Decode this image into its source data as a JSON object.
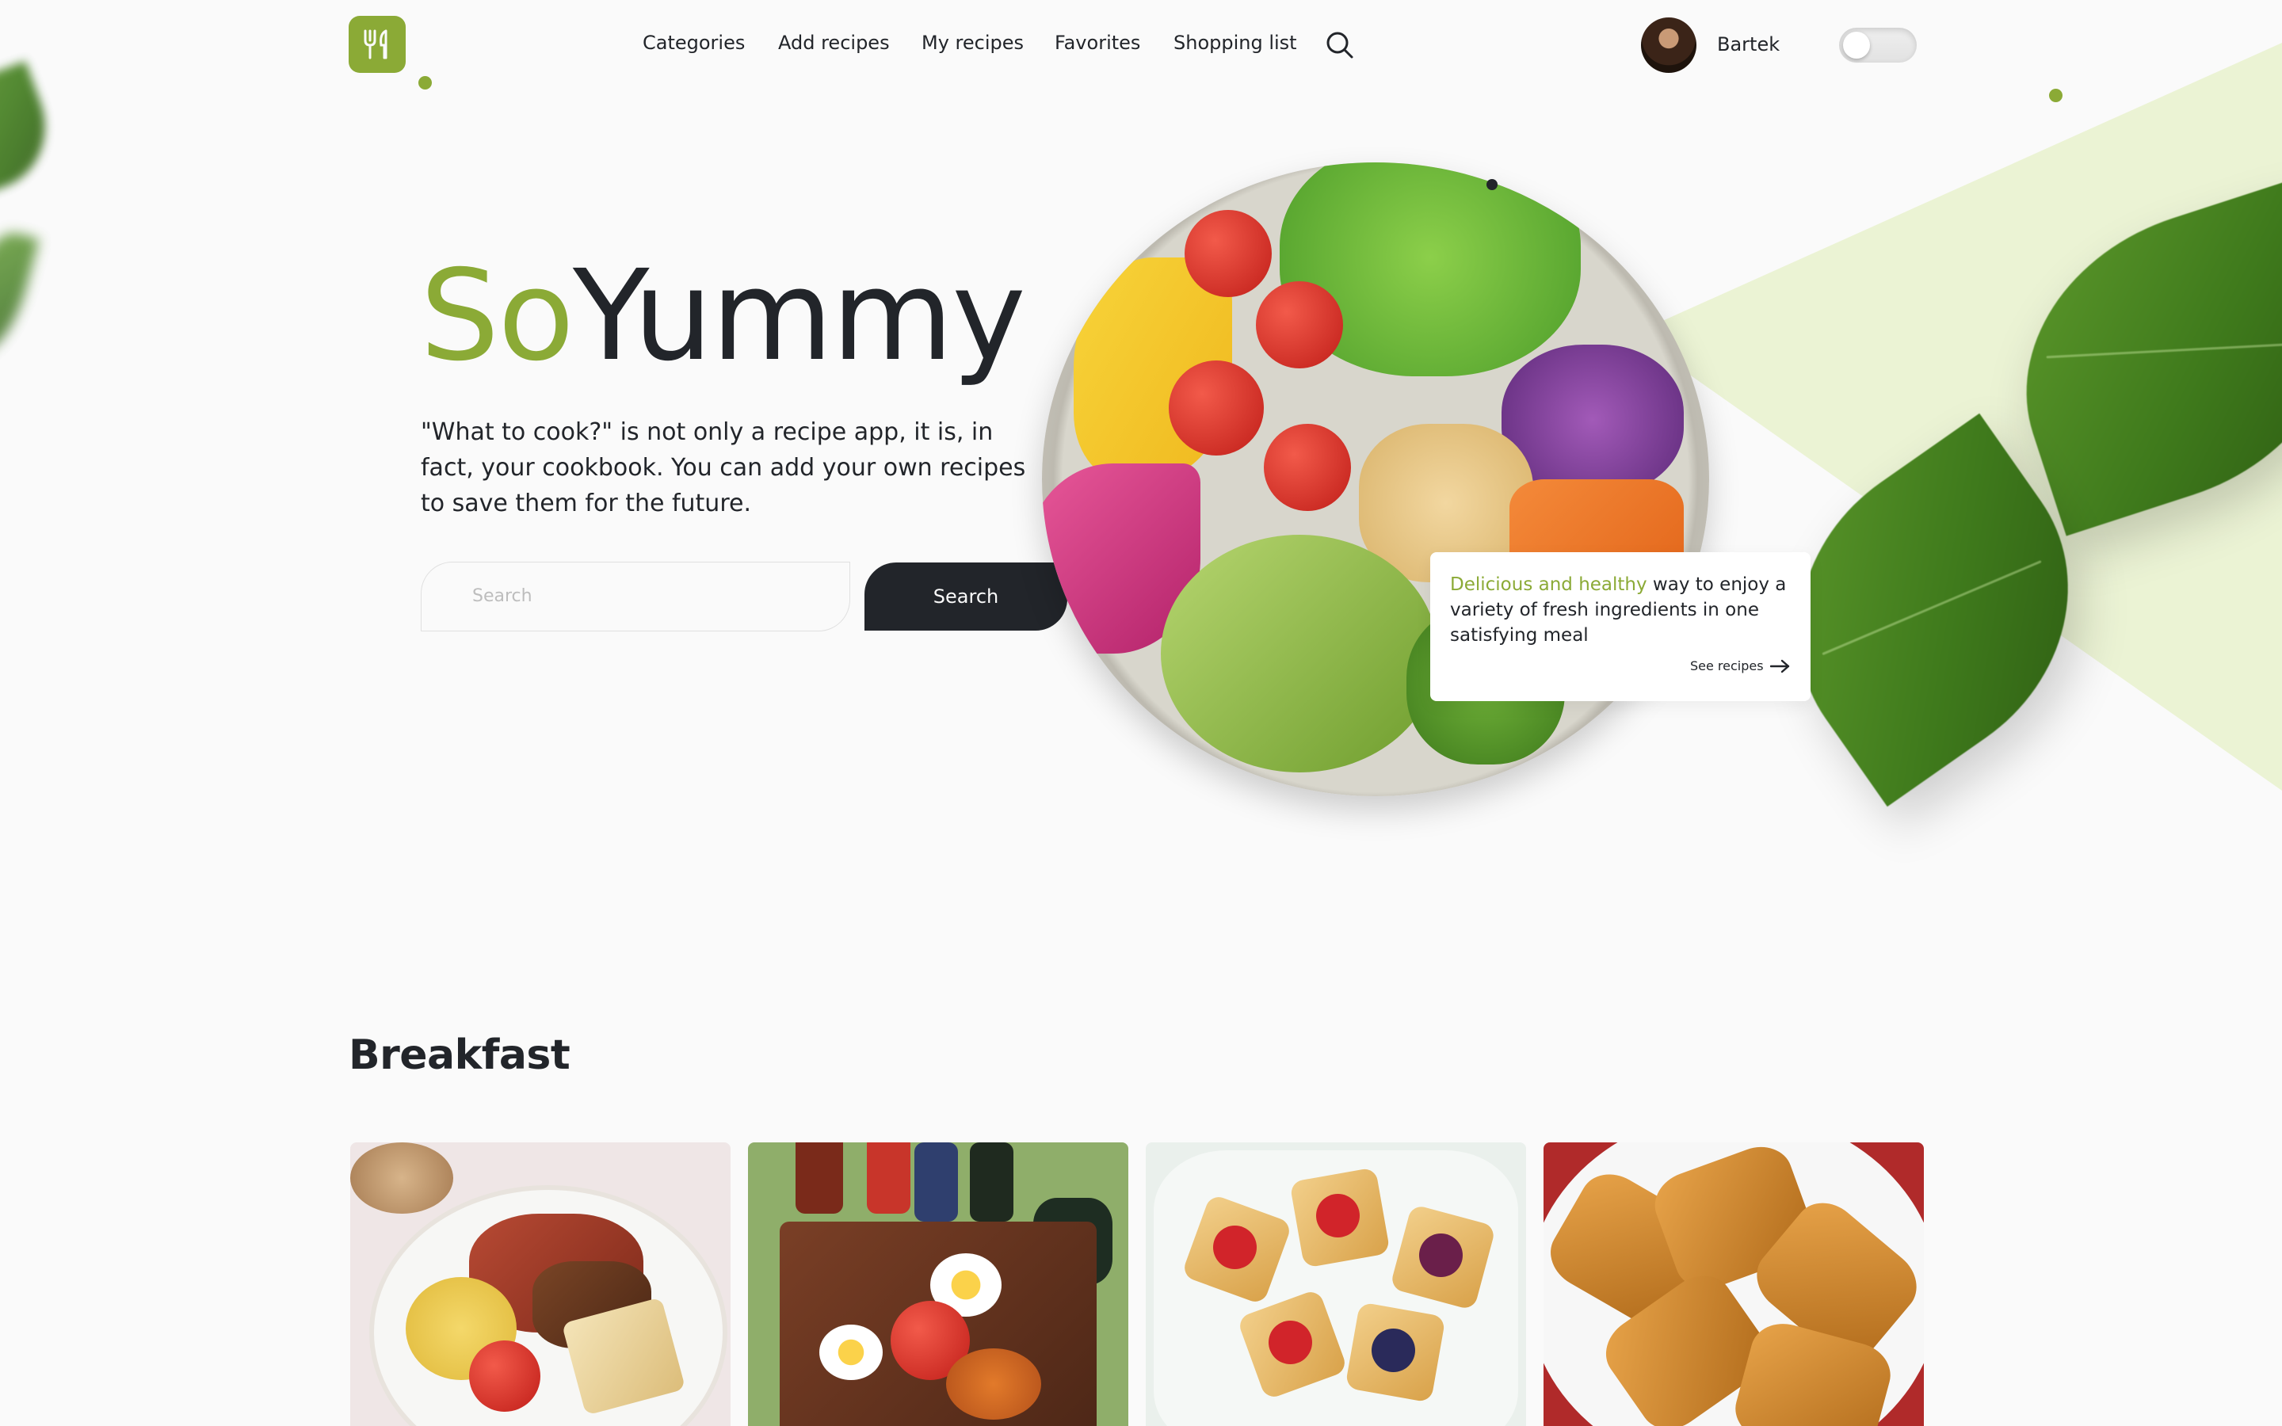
{
  "nav": {
    "items": [
      "Categories",
      "Add recipes",
      "My recipes",
      "Favorites",
      "Shopping list"
    ],
    "user_name": "Bartek"
  },
  "hero": {
    "brand_accent": "So",
    "brand_main": "Yummy",
    "description": "\"What to cook?\" is not only a recipe app, it is, in fact, your cookbook. You can add your own recipes to save them for the future.",
    "search_placeholder": "Search",
    "search_button": "Search"
  },
  "callout": {
    "accent_text": "Delicious and healthy",
    "text": " way to enjoy a variety of fresh ingredients in one satisfying meal",
    "link_label": "See recipes"
  },
  "breakfast": {
    "title": "Breakfast"
  },
  "colors": {
    "accent": "#8baa36",
    "dark": "#22252a",
    "background": "#fafafa",
    "band": "#ebf3d4"
  },
  "icons": [
    "logo-icon",
    "search-icon",
    "arrow-right-icon"
  ]
}
